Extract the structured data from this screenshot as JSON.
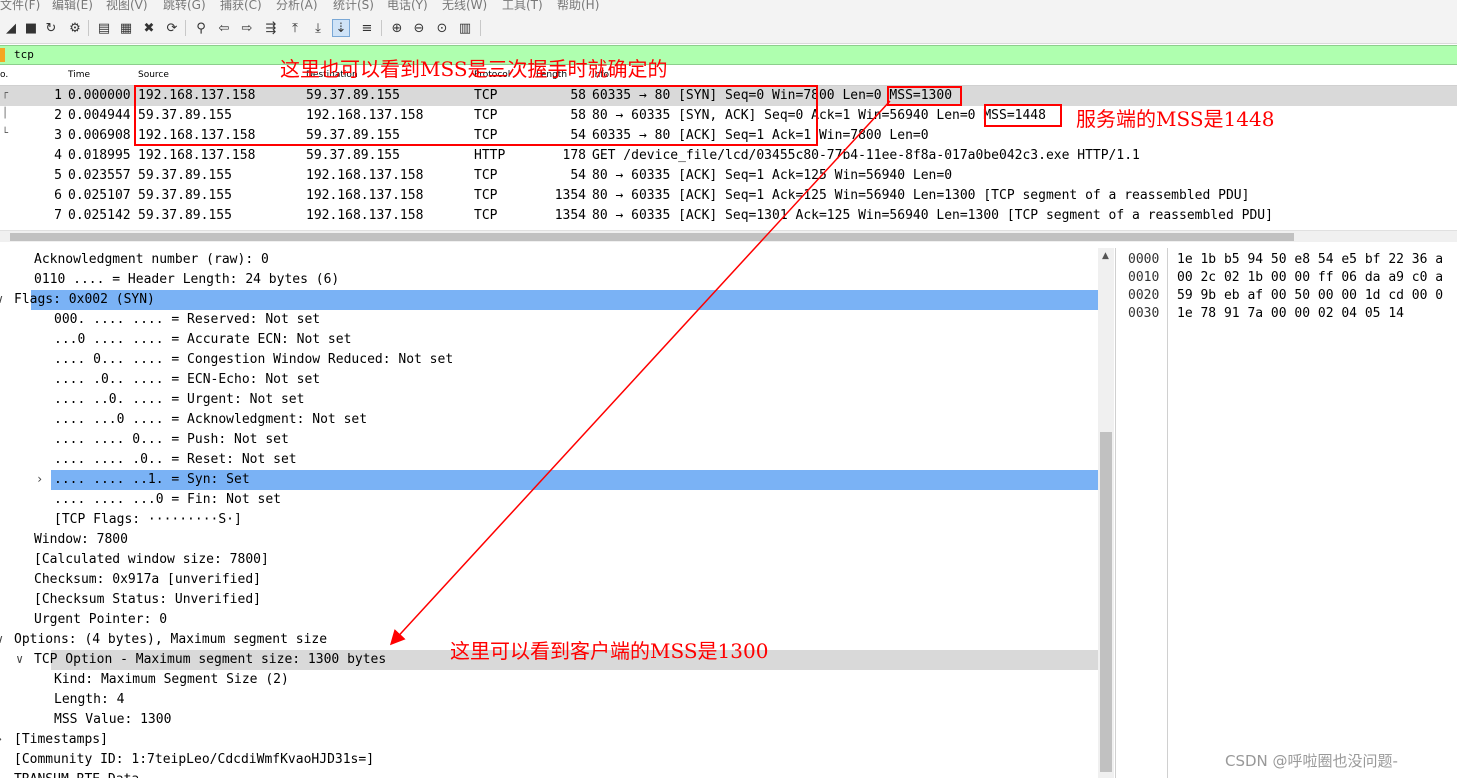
{
  "menu": [
    "文件(F)",
    "编辑(E)",
    "视图(V)",
    "跳转(G)",
    "捕获(C)",
    "分析(A)",
    "统计(S)",
    "电话(Y)",
    "无线(W)",
    "工具(T)",
    "帮助(H)"
  ],
  "toolbar_icons": [
    "shark-fin-icon",
    "stop-icon",
    "restart-icon",
    "options-gear-icon",
    "open-file-icon",
    "save-file-icon",
    "close-file-icon",
    "reload-icon",
    "find-packet-icon",
    "go-back-icon",
    "go-forward-icon",
    "go-to-packet-icon",
    "go-first-icon",
    "go-last-icon",
    "autoscroll-icon",
    "colorize-icon",
    "zoom-in-icon",
    "zoom-out-icon",
    "zoom-normal-icon",
    "resize-columns-icon"
  ],
  "filter": {
    "value": "tcp"
  },
  "packet_list": {
    "columns": [
      "o.",
      "Time",
      "Source",
      "Destination",
      "Protocol",
      "Length",
      "Info"
    ],
    "rows": [
      {
        "no": "1",
        "time": "0.000000",
        "src": "192.168.137.158",
        "dst": "59.37.89.155",
        "proto": "TCP",
        "len": "58",
        "info": "60335 → 80 [SYN] Seq=0 Win=7800 Len=0 MSS=1300"
      },
      {
        "no": "2",
        "time": "0.004944",
        "src": "59.37.89.155",
        "dst": "192.168.137.158",
        "proto": "TCP",
        "len": "58",
        "info": "80 → 60335 [SYN, ACK] Seq=0 Ack=1 Win=56940 Len=0 MSS=1448"
      },
      {
        "no": "3",
        "time": "0.006908",
        "src": "192.168.137.158",
        "dst": "59.37.89.155",
        "proto": "TCP",
        "len": "54",
        "info": "60335 → 80 [ACK] Seq=1 Ack=1 Win=7800 Len=0"
      },
      {
        "no": "4",
        "time": "0.018995",
        "src": "192.168.137.158",
        "dst": "59.37.89.155",
        "proto": "HTTP",
        "len": "178",
        "info": "GET /device_file/lcd/03455c80-77b4-11ee-8f8a-017a0be042c3.exe HTTP/1.1"
      },
      {
        "no": "5",
        "time": "0.023557",
        "src": "59.37.89.155",
        "dst": "192.168.137.158",
        "proto": "TCP",
        "len": "54",
        "info": "80 → 60335 [ACK] Seq=1 Ack=125 Win=56940 Len=0"
      },
      {
        "no": "6",
        "time": "0.025107",
        "src": "59.37.89.155",
        "dst": "192.168.137.158",
        "proto": "TCP",
        "len": "1354",
        "info": "80 → 60335 [ACK] Seq=1 Ack=125 Win=56940 Len=1300 [TCP segment of a reassembled PDU]"
      },
      {
        "no": "7",
        "time": "0.025142",
        "src": "59.37.89.155",
        "dst": "192.168.137.158",
        "proto": "TCP",
        "len": "1354",
        "info": "80 → 60335 [ACK] Seq=1301 Ack=125 Win=56940 Len=1300 [TCP segment of a reassembled PDU]"
      }
    ]
  },
  "details": [
    {
      "text": "Acknowledgment number (raw): 0",
      "toggle": ""
    },
    {
      "text": "0110 .... = Header Length: 24 bytes (6)",
      "toggle": ""
    },
    {
      "text": "Flags: 0x002 (SYN)",
      "toggle": "∨"
    },
    {
      "text": "000. .... .... = Reserved: Not set",
      "toggle": ""
    },
    {
      "text": "...0 .... .... = Accurate ECN: Not set",
      "toggle": ""
    },
    {
      "text": ".... 0... .... = Congestion Window Reduced: Not set",
      "toggle": ""
    },
    {
      "text": ".... .0.. .... = ECN-Echo: Not set",
      "toggle": ""
    },
    {
      "text": ".... ..0. .... = Urgent: Not set",
      "toggle": ""
    },
    {
      "text": ".... ...0 .... = Acknowledgment: Not set",
      "toggle": ""
    },
    {
      "text": ".... .... 0... = Push: Not set",
      "toggle": ""
    },
    {
      "text": ".... .... .0.. = Reset: Not set",
      "toggle": ""
    },
    {
      "text": ".... .... ..1. = Syn: Set",
      "toggle": "›"
    },
    {
      "text": ".... .... ...0 = Fin: Not set",
      "toggle": ""
    },
    {
      "text": "[TCP Flags: ·········S·]",
      "toggle": ""
    },
    {
      "text": "Window: 7800",
      "toggle": ""
    },
    {
      "text": "[Calculated window size: 7800]",
      "toggle": ""
    },
    {
      "text": "Checksum: 0x917a [unverified]",
      "toggle": ""
    },
    {
      "text": "[Checksum Status: Unverified]",
      "toggle": ""
    },
    {
      "text": "Urgent Pointer: 0",
      "toggle": ""
    },
    {
      "text": "Options: (4 bytes), Maximum segment size",
      "toggle": "∨"
    },
    {
      "text": "TCP Option - Maximum segment size: 1300 bytes",
      "toggle": "∨"
    },
    {
      "text": "Kind: Maximum Segment Size (2)",
      "toggle": ""
    },
    {
      "text": "Length: 4",
      "toggle": ""
    },
    {
      "text": "MSS Value: 1300",
      "toggle": ""
    },
    {
      "text": "[Timestamps]",
      "toggle": "›"
    },
    {
      "text": "[Community ID: 1:7teipLeo/CdcdiWmfKvaoHJD31s=]",
      "toggle": ""
    },
    {
      "text": "TRANSUM RTE Data",
      "toggle": ""
    }
  ],
  "bytes": [
    {
      "offset": "0000",
      "hex": "1e 1b b5 94 50 e8 54 e5  bf 22 36 a"
    },
    {
      "offset": "0010",
      "hex": "00 2c 02 1b 00 00 ff 06  da a9 c0 a"
    },
    {
      "offset": "0020",
      "hex": "59 9b eb af 00 50 00 00  1d cd 00 0"
    },
    {
      "offset": "0030",
      "hex": "1e 78 91 7a 00 00 02 04  05 14"
    }
  ],
  "annotations": {
    "top": "这里也可以看到MSS是三次握手时就确定的",
    "server": "服务端的MSS是1448",
    "client": "这里可以看到客户端的MSS是1300",
    "watermark": "CSDN @呼啦圈也没问题-"
  },
  "colors": {
    "filter_bg": "#afffaf",
    "selection_blue": "#7ab2f5",
    "annotation_red": "#ff0000"
  }
}
